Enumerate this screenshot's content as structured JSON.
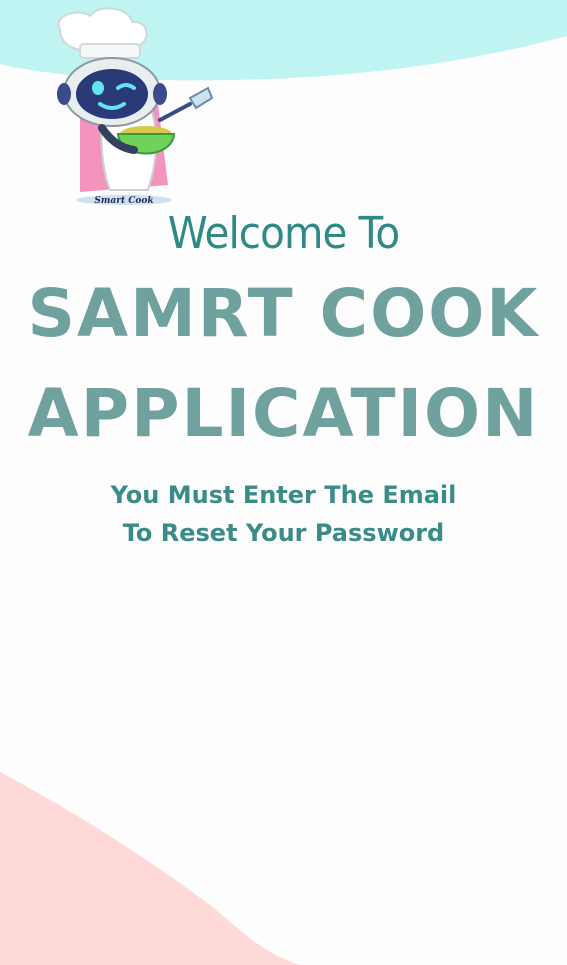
{
  "logo": {
    "caption": "Smart Cook"
  },
  "heading": {
    "welcome": "Welcome To",
    "app_name_line1": "SAMRT COOK",
    "app_name_line2": "APPLICATION"
  },
  "instructions": {
    "line1": "You Must Enter The Email",
    "line2": "To Reset Your Password"
  },
  "colors": {
    "top_wave": "#bff4f3",
    "bottom_wave": "#ffd9d7",
    "accent_teal": "#2f8a86",
    "title_teal": "#6fa19f"
  }
}
